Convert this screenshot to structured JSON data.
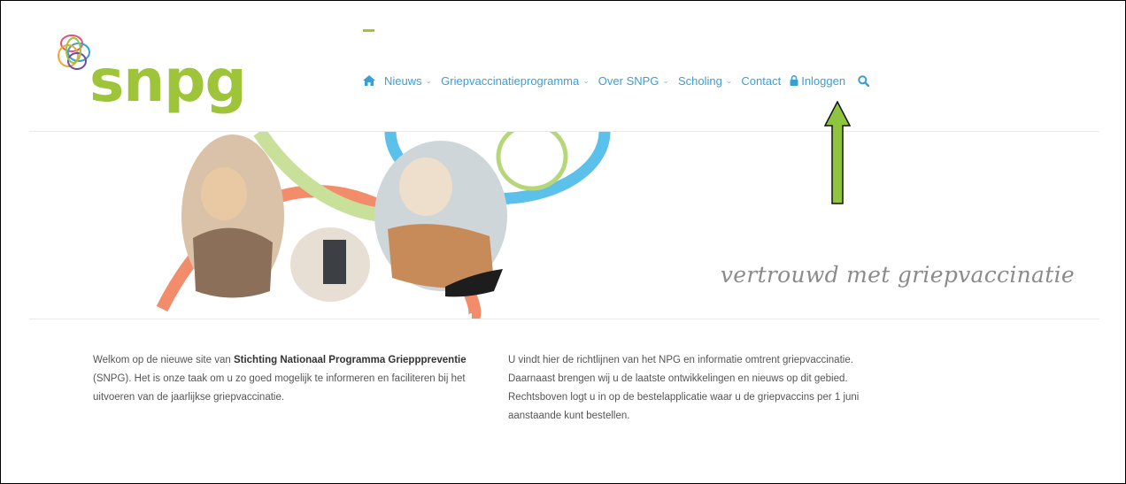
{
  "brand": {
    "name": "snpg",
    "green": "#9ec43a",
    "blue": "#3a9fd6"
  },
  "nav": {
    "home_icon": "home-icon",
    "items": [
      {
        "label": "Nieuws",
        "has_menu": true
      },
      {
        "label": "Griepvaccinatieprogramma",
        "has_menu": true
      },
      {
        "label": "Over SNPG",
        "has_menu": true
      },
      {
        "label": "Scholing",
        "has_menu": true
      },
      {
        "label": "Contact",
        "has_menu": false
      }
    ],
    "login_label": "Inloggen",
    "login_icon": "lock-icon",
    "search_icon": "search-icon"
  },
  "hero": {
    "tagline": "vertrouwd met griepvaccinatie"
  },
  "intro": {
    "left": {
      "p1": "Welkom op de nieuwe site van ",
      "bold": "Stichting Nationaal Programma Griepppreventie",
      "p2": " (SNPG). Het is onze taak om u zo goed mogelijk te informeren en faciliteren bij het uitvoeren van de jaarlijkse griepvaccinatie."
    },
    "right": "U vindt hier de richtlijnen van het NPG en informatie omtrent griepvaccinatie. Daarnaast brengen wij u de laatste ontwikkelingen en nieuws op dit gebied. Rechtsboven logt u in op de bestelapplicatie waar u de griepvaccins per 1 juni aanstaande kunt bestellen."
  },
  "annotation": {
    "arrow_color": "#8fc43f"
  }
}
